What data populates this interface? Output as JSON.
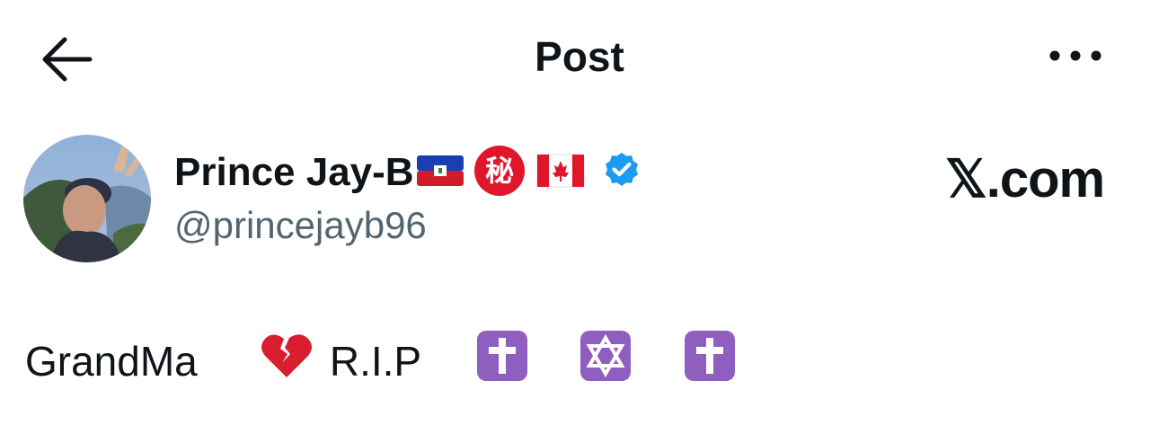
{
  "header": {
    "title": "Post",
    "back_icon": "arrow-left-icon",
    "more_icon": "more-horizontal-icon"
  },
  "author": {
    "display_name": "Prince Jay-B",
    "handle": "@princejayb96",
    "flags": [
      "haiti-flag-icon",
      "secret-ideograph-icon",
      "canada-flag-icon"
    ],
    "secret_glyph": "秘",
    "verified_icon": "verified-badge-icon",
    "avatar_icon": "avatar"
  },
  "watermark": "𝕏.com",
  "post": {
    "word_1": "GrandMa",
    "word_2": "R.I.P",
    "emojis": [
      "broken-heart-icon",
      "latin-cross-icon",
      "star-of-david-icon",
      "latin-cross-icon"
    ]
  },
  "colors": {
    "verified_blue": "#1d9bf0",
    "handle_gray": "#536471",
    "text": "#0f1419",
    "religious_purple": "#8e5fbf",
    "secret_red": "#e0162b"
  }
}
